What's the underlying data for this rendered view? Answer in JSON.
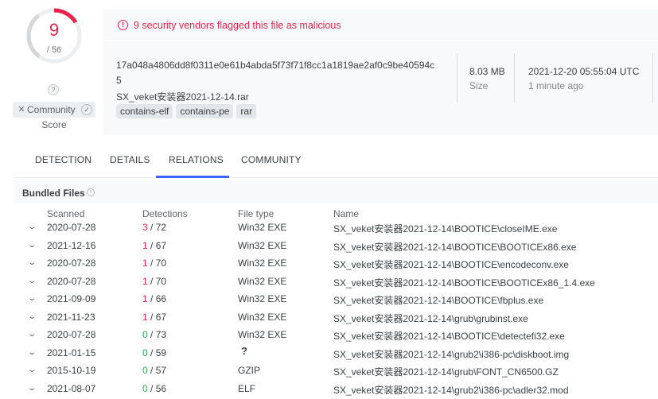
{
  "score": {
    "detections": "9",
    "total": "/ 56",
    "unknown_badge": "?",
    "community_label": "Community",
    "score_label": "Score",
    "ring_fraction": 0.1607
  },
  "summary": {
    "alert": "9 security vendors flagged this file as malicious",
    "hash_line1": "17a048a4806dd8f0311e0e61b4abda5f73f71f8cc1a1819ae2af0c9be40594c",
    "hash_line2": "5",
    "filename": "SX_veket安装器2021-12-14.rar",
    "tags": [
      "contains-elf",
      "contains-pe",
      "rar"
    ],
    "size_value": "8.03 MB",
    "size_label": "Size",
    "date_value": "2021-12-20 05:55:04 UTC",
    "date_label": "1 minute ago"
  },
  "tabs": [
    "DETECTION",
    "DETAILS",
    "RELATIONS",
    "COMMUNITY"
  ],
  "active_tab": "RELATIONS",
  "bundled": {
    "title": "Bundled Files",
    "headers": {
      "scanned": "Scanned",
      "detections": "Detections",
      "file_type": "File type",
      "name": "Name"
    },
    "rows": [
      {
        "scanned": "2020-07-28",
        "det": "3",
        "total": " / 72",
        "type": "Win32 EXE",
        "name": "SX_veket安装器2021-12-14\\BOOTICE\\closeIME.exe"
      },
      {
        "scanned": "2021-12-16",
        "det": "1",
        "total": " / 67",
        "type": "Win32 EXE",
        "name": "SX_veket安装器2021-12-14\\BOOTICE\\BOOTICEx86.exe"
      },
      {
        "scanned": "2020-07-28",
        "det": "1",
        "total": " / 70",
        "type": "Win32 EXE",
        "name": "SX_veket安装器2021-12-14\\BOOTICE\\encodeconv.exe"
      },
      {
        "scanned": "2020-07-28",
        "det": "1",
        "total": " / 70",
        "type": "Win32 EXE",
        "name": "SX_veket安装器2021-12-14\\BOOTICE\\BOOTICEx86_1.4.exe"
      },
      {
        "scanned": "2021-09-09",
        "det": "1",
        "total": " / 66",
        "type": "Win32 EXE",
        "name": "SX_veket安装器2021-12-14\\BOOTICE\\fbplus.exe"
      },
      {
        "scanned": "2021-11-23",
        "det": "1",
        "total": " / 67",
        "type": "Win32 EXE",
        "name": "SX_veket安装器2021-12-14\\grub\\grubinst.exe"
      },
      {
        "scanned": "2020-07-28",
        "det": "0",
        "total": " / 73",
        "type": "Win32 EXE",
        "name": "SX_veket安装器2021-12-14\\BOOTICE\\detectefi32.exe"
      },
      {
        "scanned": "2021-01-15",
        "det": "0",
        "total": " / 59",
        "type": "?",
        "name": "SX_veket安装器2021-12-14\\grub2\\i386-pc\\diskboot.img"
      },
      {
        "scanned": "2015-10-19",
        "det": "0",
        "total": " / 57",
        "type": "GZIP",
        "name": "SX_veket安装器2021-12-14\\grub\\FONT_CN6500.GZ"
      },
      {
        "scanned": "2021-08-07",
        "det": "0",
        "total": " / 56",
        "type": "ELF",
        "name": "SX_veket安装器2021-12-14\\grub2\\i386-pc\\adler32.mod"
      }
    ]
  },
  "colors": {
    "malicious": "#e8234c",
    "clean": "#33a852",
    "accent": "#3b61ff"
  },
  "icons": [
    "alert-circle-icon",
    "info-icon",
    "close-icon",
    "check-icon",
    "chevron-down-icon"
  ]
}
